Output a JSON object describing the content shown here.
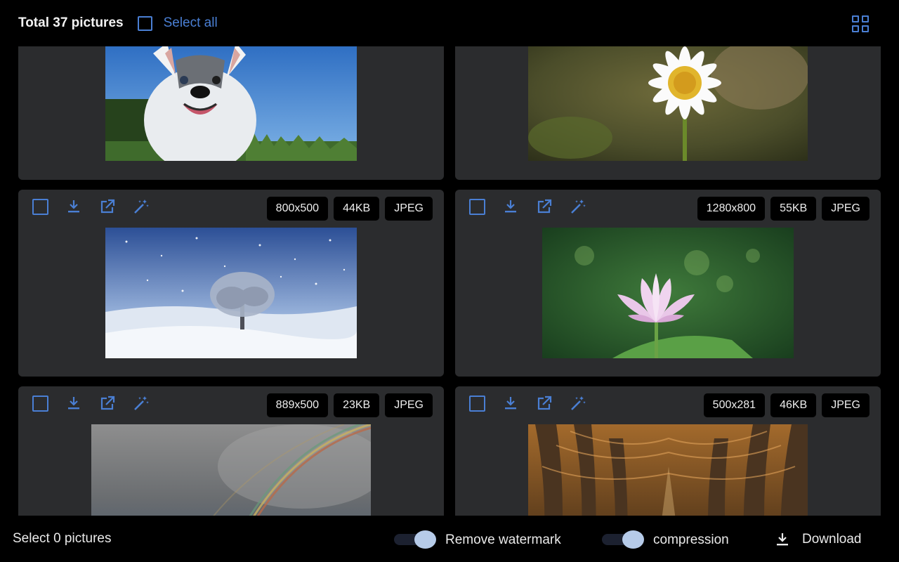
{
  "header": {
    "total_label": "Total 37 pictures",
    "select_all_label": "Select all",
    "view_toggle_icon": "grid-view-icon"
  },
  "accent_color": "#4a7fd4",
  "cards": [
    {
      "id": "husky",
      "resolution": "",
      "size": "",
      "format": ""
    },
    {
      "id": "daisy",
      "resolution": "",
      "size": "",
      "format": ""
    },
    {
      "id": "snow-tree",
      "resolution": "800x500",
      "size": "44KB",
      "format": "JPEG"
    },
    {
      "id": "lotus",
      "resolution": "1280x800",
      "size": "55KB",
      "format": "JPEG"
    },
    {
      "id": "rainbow",
      "resolution": "889x500",
      "size": "23KB",
      "format": "JPEG"
    },
    {
      "id": "forest-path",
      "resolution": "500x281",
      "size": "46KB",
      "format": "JPEG"
    }
  ],
  "card_tools": [
    "checkbox-icon",
    "download-icon",
    "open-external-icon",
    "magic-wand-icon"
  ],
  "footer": {
    "selected_label": "Select 0 pictures",
    "remove_watermark_label": "Remove watermark",
    "compression_label": "compression",
    "download_label": "Download"
  }
}
